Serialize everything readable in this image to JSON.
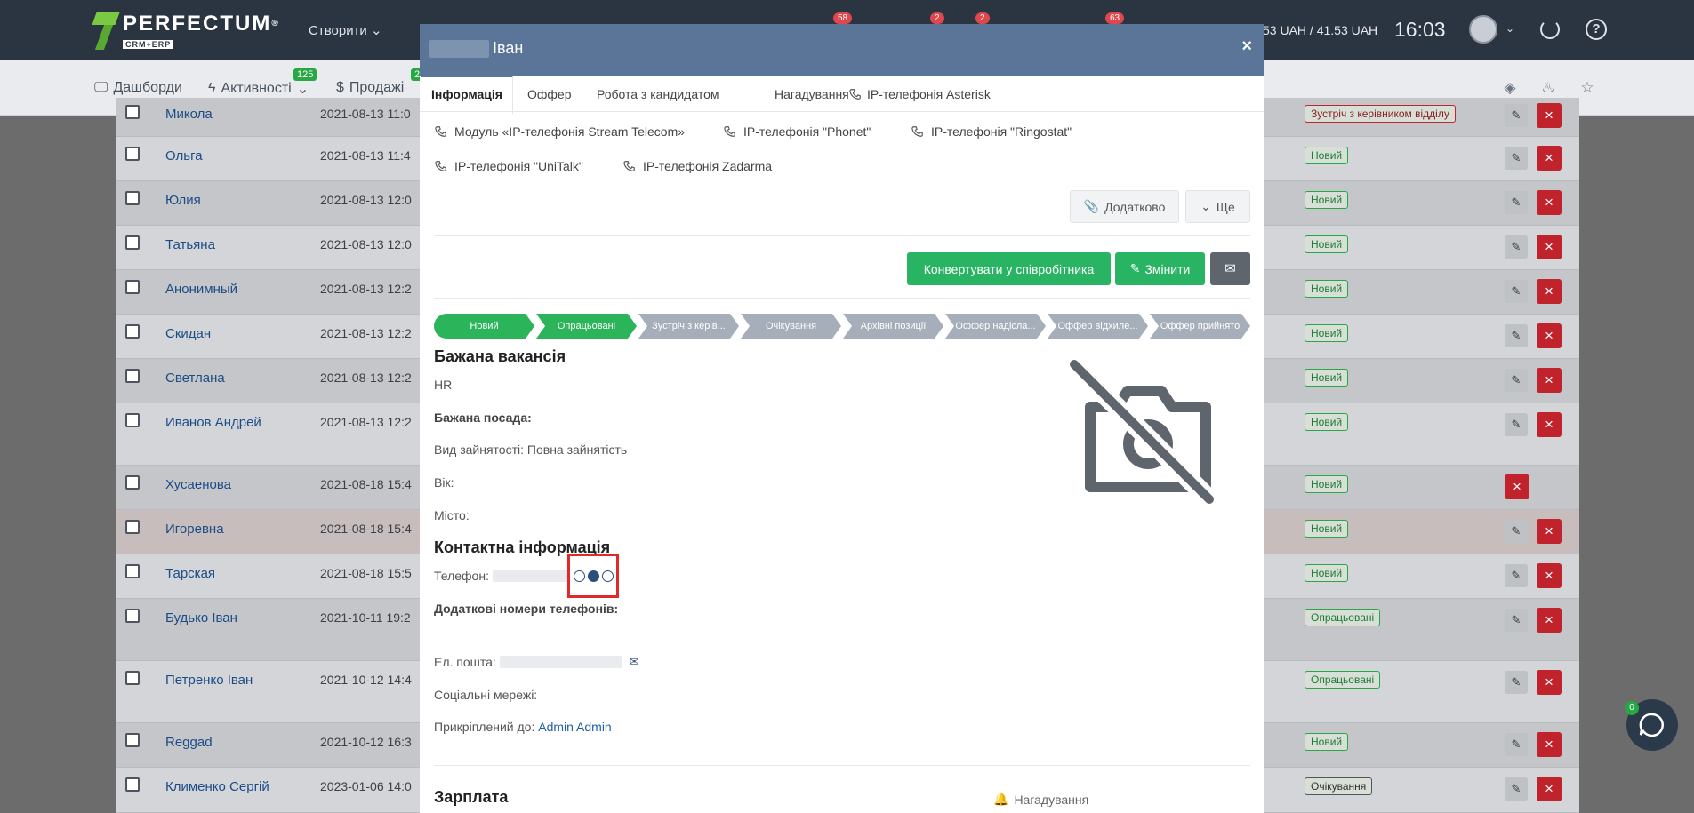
{
  "topbar": {
    "logo_text": "PERFECTUM",
    "logo_sub": "CRM+ERP",
    "create_label": "Створити",
    "badges": [
      "58",
      "2",
      "2",
      "63"
    ],
    "balance": "53 UAH / 41.53 UAH",
    "time": "16:03"
  },
  "subnav": {
    "dashboards": "Дашборди",
    "activity": "Активності",
    "activity_badge": "125",
    "sales": "Продажі",
    "sales_badge": "2"
  },
  "background_rows": [
    {
      "name": "Микола",
      "date": "2021-08-13 11:0",
      "status": "Зустріч з керівником відділу"
    },
    {
      "name": "Ольга",
      "date": "2021-08-13 11:4",
      "status": "Новий"
    },
    {
      "name": "Юлия",
      "date": "2021-08-13 12:0",
      "status": "Новий"
    },
    {
      "name": "Татьяна",
      "date": "2021-08-13 12:0",
      "status": "Новий"
    },
    {
      "name": "Анонимный",
      "date": "2021-08-13 12:2",
      "status": "Новий"
    },
    {
      "name": "Скидан",
      "date": "2021-08-13 12:2",
      "status": "Новий"
    },
    {
      "name": "Светлана",
      "date": "2021-08-13 12:2",
      "status": "Новий"
    },
    {
      "name": "Иванов Андрей",
      "date": "2021-08-13 12:2",
      "status": "Новий"
    },
    {
      "name": "Хусаенова",
      "date": "2021-08-18 15:4",
      "status": "Новий"
    },
    {
      "name": "Игоревна",
      "date": "2021-08-18 15:4",
      "status": "Новий"
    },
    {
      "name": "Тарская",
      "date": "2021-08-18 15:5",
      "status": "Новий"
    },
    {
      "name": "Будько Іван",
      "date": "2021-10-11 19:2",
      "status": "Опрацьовані"
    },
    {
      "name": "Петренко Іван",
      "date": "2021-10-12 14:4",
      "status": "Опрацьовані"
    },
    {
      "name": "Reggad",
      "date": "2021-10-12 16:3",
      "status": "Новий"
    },
    {
      "name": "Клименко Сергій",
      "date": "2023-01-06 14:0",
      "status": "Очікування"
    }
  ],
  "modal": {
    "title": "Іван",
    "close": "×",
    "tabs": [
      "Інформація",
      "Оффер",
      "Робота з кандидатом",
      "Нагадування",
      "IP-телефонія Asterisk"
    ],
    "subtabs": [
      "Модуль «IP-телефонія Stream Telecom»",
      "IP-телефонія \"Phonet\"",
      "IP-телефонія \"Ringostat\"",
      "IP-телефонія \"UniTalk\"",
      "IP-телефонія Zadarma"
    ],
    "extra_btn": "Додатково",
    "more_btn": "Ще",
    "convert_btn": "Конвертувати у співробітника",
    "edit_btn": "Змінити",
    "pipeline": [
      "Новий",
      "Опрацьовані",
      "Зустріч з керів...",
      "Очікування",
      "Архівні позиції",
      "Оффер надісла...",
      "Оффер відхиле...",
      "Оффер прийнято"
    ],
    "vacancy_heading": "Бажана вакансія",
    "vacancy_value": "HR",
    "position_label": "Бажана посада:",
    "employment_label": "Вид зайнятості:",
    "employment_value": "Повна зайнятість",
    "age_label": "Вік:",
    "city_label": "Місто:",
    "contact_heading": "Контактна інформація",
    "phone_label": "Телефон:",
    "extra_phones_label": "Додаткові номери телефонів:",
    "email_label": "Ел. пошта:",
    "social_label": "Соціальні мережі:",
    "attached_label": "Прикріплений до:",
    "attached_value": "Admin Admin",
    "salary_heading": "Зарплата",
    "reminder_label": "Нагадування"
  },
  "chat_badge": "0"
}
